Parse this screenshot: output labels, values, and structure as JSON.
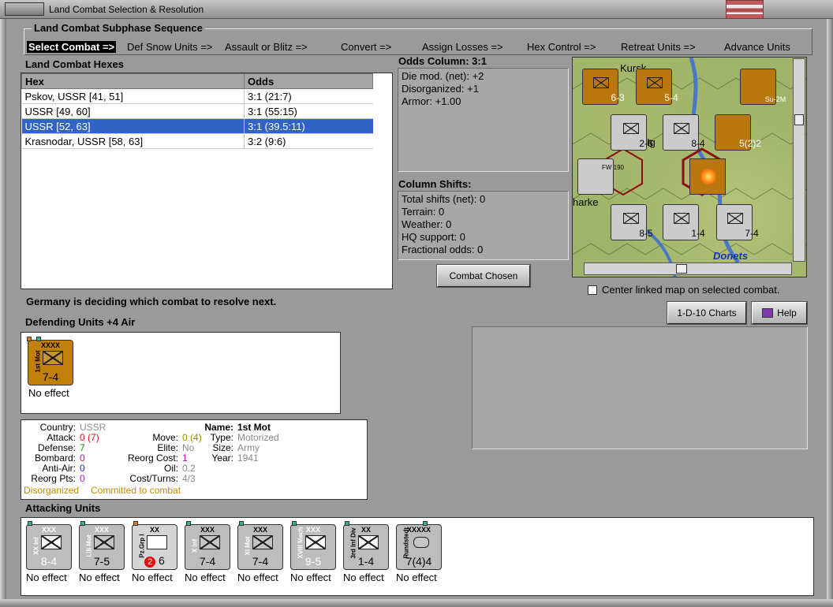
{
  "window": {
    "title": "Land Combat Selection & Resolution"
  },
  "subphase": {
    "title": "Land Combat Subphase Sequence",
    "items": [
      "Select Combat =>",
      "Def Snow Units =>",
      "Assault or Blitz =>",
      "Convert =>",
      "Assign Losses =>",
      "Hex Control =>",
      "Retreat Units =>",
      "Advance Units"
    ]
  },
  "hexes": {
    "label": "Land Combat Hexes",
    "columns": [
      "Hex",
      "Odds"
    ],
    "rows": [
      {
        "hex": "Pskov, USSR [41, 51]",
        "odds": "3:1 (21:7)"
      },
      {
        "hex": "USSR [49, 60]",
        "odds": "3:1 (55:15)"
      },
      {
        "hex": "USSR [52, 63]",
        "odds": "3:1 (39.5:11)"
      },
      {
        "hex": "Krasnodar, USSR [58, 63]",
        "odds": "3:2 (9:6)"
      }
    ]
  },
  "odds": {
    "label": "Odds Column: 3:1",
    "lines": [
      "Die mod. (net): +2",
      "Disorganized: +1",
      "Armor: +1.00"
    ]
  },
  "shifts": {
    "label": "Column Shifts:",
    "lines": [
      "Total shifts (net): 0",
      "Terrain: 0",
      "Weather: 0",
      "HQ support: 0",
      "Fractional odds: 0"
    ]
  },
  "buttons": {
    "combat_chosen": "Combat Chosen",
    "charts": "1-D-10 Charts",
    "help": "Help"
  },
  "map": {
    "center_checkbox_label": "Center linked map on selected combat.",
    "labels": [
      "Kursk",
      "Ig",
      "harke",
      "Donets"
    ],
    "counters": [
      {
        "value": "6-3",
        "style": "orange"
      },
      {
        "value": "5-4",
        "style": "orange"
      },
      {
        "value": "Su-2M",
        "style": "orange"
      },
      {
        "value": "2-6",
        "style": "grey"
      },
      {
        "value": "8-4",
        "style": "grey"
      },
      {
        "value": "5(2)2",
        "style": "orange"
      },
      {
        "value": "FW 190",
        "style": "grey"
      },
      {
        "value": "8-5",
        "style": "grey"
      },
      {
        "value": "1-4",
        "style": "grey"
      },
      {
        "value": "7-4",
        "style": "grey"
      }
    ]
  },
  "status": "Germany is deciding which combat to resolve next.",
  "defending": {
    "label": "Defending Units +4 Air",
    "units": [
      {
        "name": "1st Mot",
        "size": "XXXX",
        "value": "7-4",
        "status": "No effect"
      }
    ]
  },
  "unit_info": {
    "country_label": "Country:",
    "country": "USSR",
    "attack_label": "Attack:",
    "attack": "0",
    "attack_extra": "(7)",
    "defense_label": "Defense:",
    "defense": "7",
    "bombard_label": "Bombard:",
    "bombard": "0",
    "antiair_label": "Anti-Air:",
    "antiair": "0",
    "reorg_pts_label": "Reorg Pts:",
    "reorg_pts": "0",
    "move_label": "Move:",
    "move": "0",
    "move_extra": "(4)",
    "elite_label": "Elite:",
    "elite": "No",
    "reorg_cost_label": "Reorg Cost:",
    "reorg_cost": "1",
    "oil_label": "Oil:",
    "oil": "0.2",
    "cost_turns_label": "Cost/Turns:",
    "cost_turns": "4/3",
    "name_label": "Name:",
    "name": "1st Mot",
    "type_label": "Type:",
    "type": "Motorized",
    "size_label": "Size:",
    "size": "Army",
    "year_label": "Year:",
    "year": "1941",
    "disorganized": "Disorganized",
    "committed": "Committed to combat"
  },
  "attacking": {
    "label": "Attacking Units",
    "units": [
      {
        "name": "XX Inf",
        "size": "XXX",
        "value": "8-4",
        "status": "No effect"
      },
      {
        "name": "LIII Mot",
        "size": "XXX",
        "value": "7-5",
        "status": "No effect"
      },
      {
        "name": "Pz.Grp I",
        "size": "XX",
        "value": "6",
        "badge": "2",
        "status": "No effect"
      },
      {
        "name": "X Inf",
        "size": "XXX",
        "value": "7-4",
        "status": "No effect"
      },
      {
        "name": "XI Mot",
        "size": "XXX",
        "value": "7-4",
        "status": "No effect"
      },
      {
        "name": "XVIII Mech",
        "size": "XXX",
        "value": "9-5",
        "status": "No effect"
      },
      {
        "name": "3rd Inf Div",
        "size": "XX",
        "value": "1-4",
        "status": "No effect"
      },
      {
        "name": "Rundstedt",
        "size": "XXXXX",
        "value": "7(4)4",
        "status": "No effect"
      }
    ]
  }
}
